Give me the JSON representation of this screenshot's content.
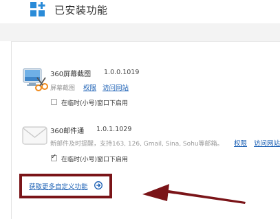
{
  "header": {
    "title": "已安装功能",
    "icon": "grid-plus-icon",
    "accent": "#2a8bd8"
  },
  "apps": [
    {
      "name": "360屏幕截图",
      "version": "1.0.0.1019",
      "description": "屏幕截图",
      "links": [
        "权限",
        "访问网站"
      ],
      "option_label": "在临时(小号)窗口下启用",
      "option_checked": false,
      "icon": "screenshot-scissors-icon"
    },
    {
      "name": "360邮件通",
      "version": "1.0.1.1029",
      "description": "新邮件及时提醒，支持163, 126, Gmail, Sina, Sohu等邮箱。",
      "links": [
        "权限",
        "访问网站"
      ],
      "option_label": "在临时(小号)窗口下启用",
      "option_checked": true,
      "icon": "envelope-icon"
    }
  ],
  "footer": {
    "more_link": "获取更多自定义功能",
    "more_icon": "circle-arrow-right-icon"
  },
  "colors": {
    "link": "#1a5fb4",
    "highlight": "#7a1418"
  }
}
